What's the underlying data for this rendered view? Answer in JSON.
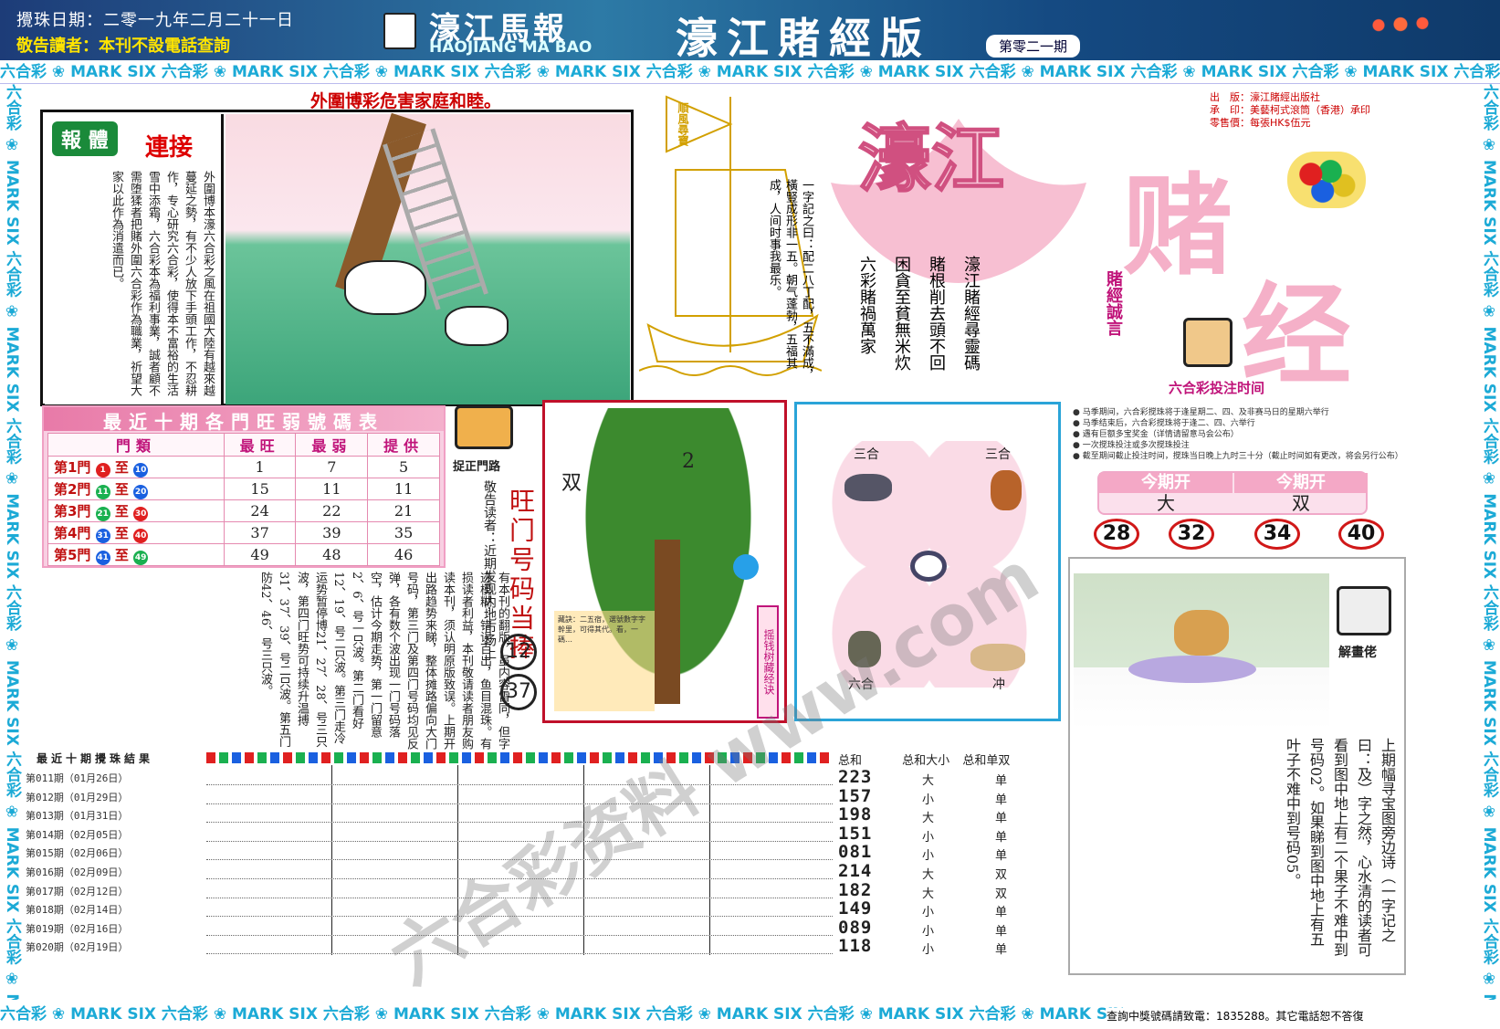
{
  "header": {
    "date": "攪珠日期：二零一九年二月二十一日",
    "notice": "敬告讀者：本刊不設電話查詢",
    "logo_cn": "濠江馬報",
    "logo_en": "HAOJIANG MA BAO",
    "title": "濠江賭經版",
    "issue": "第零二一期"
  },
  "band_text": "六合彩 ❀ MARK SIX 六合彩 ❀ MARK SIX 六合彩 ❀ MARK SIX 六合彩 ❀ MARK SIX 六合彩 ❀ MARK SIX 六合彩 ❀ MARK SIX 六合彩 ❀ MARK SIX 六合彩 ❀ MARK SIX 六合彩 ❀ MARK SIX 六合彩 ❀ MARK SIX",
  "ad": {
    "title": "外圍博彩危害家庭和睦。",
    "label": "報 體",
    "label2": "連接",
    "text": "外圍博本濠六合彩之風在祖國大陸有越來越蔓延之勢，有不少人放下手頭工作，不忍耕作，专心研究六合彩，使得本不富裕的生活雪中添霜，六合彩本為福利事業，誠者顧不需堕猱者把賭外圍六合彩作為職業，祈望大家以此作為消遣而已。"
  },
  "boat": {
    "flag": "順風尋寶",
    "text": "一字記之曰：配二八丁配，五不滿成，橫豎成形非一五。朝气蓬勃，五福其成，人间时事我最乐。"
  },
  "logo": {
    "haojiang": "濠江",
    "du": "赌",
    "jing": "经",
    "lines": [
      "六彩賭禍萬家",
      "困貪至貧無米炊",
      "賭根削去頭不回",
      "濠江賭經尋靈碼"
    ],
    "motto": "賭經誠言",
    "pub": [
      "出　版：濠江賭經出版社",
      "承　印：美藝柯式滾筒（香港）承印",
      "零售價：每張HK$伍元"
    ]
  },
  "time_box": {
    "title": "六合彩投注时间",
    "notes": [
      "● 马季期间，六合彩搅珠将于逢星期二、四、及非赛马日的星期六举行",
      "● 马季结束后，六合彩搅珠将于逢二、四、六举行",
      "● 遇有巨额多宝奖金（详情请留意马会公布）",
      "● 一次搅珠投注或多次搅珠投注",
      "● 截至期间截止投注时间，搅珠当日晚上九时三十分（截止时间如有更改，将会另行公布）"
    ],
    "current_head": "今期开",
    "current_1": "大",
    "current_2": "双",
    "numbers": [
      "28",
      "32",
      "34",
      "40"
    ]
  },
  "zodiac": {
    "top_left": "三合",
    "top_right": "三合",
    "bottom_left": "六合",
    "bottom_right": "冲"
  },
  "tree": {
    "left": "双",
    "right": "2",
    "side": "摇钱树藏经诀",
    "note": "藏訣：二五宿，選號數字字幹里，可得其代。看，一碼…"
  },
  "table": {
    "title": "最近十期各門旺弱號碼表",
    "headers": [
      "門類",
      "最旺",
      "最弱",
      "提供"
    ],
    "rows": [
      {
        "door": "第1門",
        "from": "1",
        "to": "10",
        "hot": "1",
        "cold": "7",
        "pick": "5"
      },
      {
        "door": "第2門",
        "from": "11",
        "to": "20",
        "hot": "15",
        "cold": "11",
        "pick": "11"
      },
      {
        "door": "第3門",
        "from": "21",
        "to": "30",
        "hot": "24",
        "cold": "22",
        "pick": "21"
      },
      {
        "door": "第4門",
        "from": "31",
        "to": "40",
        "hot": "37",
        "cold": "39",
        "pick": "35"
      },
      {
        "door": "第5門",
        "from": "41",
        "to": "49",
        "hot": "49",
        "cold": "48",
        "pick": "46"
      }
    ],
    "between": "至"
  },
  "tips": {
    "label": "捉正門路",
    "hot_title": "旺门号码当捧",
    "hot_1": "12",
    "hot_2": "37"
  },
  "article": "有本刊的翻版，虽内容雷同，但字迹模糊，错误百出，鱼目混珠。有损读者利益，本刊敬请读者朋友购读本刊，须认明原版致误。上期开出路趋势来睇，整体摊路偏向大门号码，第三门及第四门号码均见反弹，各有数个波出现一门号码落空，估计今期走势，第一门留意2、6、号一只波。第二门看好12、19、号二只波。第三门走冷运势暂停博21、27、28、号三只波，第四门旺势可持续升温搏31、37、39、号二只波。第五门防42、46、号三只波。",
  "article_head": "敬告读者：近期发现内地市场上",
  "results": {
    "title": "最近十期攪珠結果",
    "rows": [
      {
        "label": "第011期（01月26日）",
        "sum": "223",
        "bs": "大",
        "oe": "单"
      },
      {
        "label": "第012期（01月29日）",
        "sum": "157",
        "bs": "小",
        "oe": "单"
      },
      {
        "label": "第013期（01月31日）",
        "sum": "198",
        "bs": "大",
        "oe": "单"
      },
      {
        "label": "第014期（02月05日）",
        "sum": "151",
        "bs": "小",
        "oe": "单"
      },
      {
        "label": "第015期（02月06日）",
        "sum": "081",
        "bs": "小",
        "oe": "单"
      },
      {
        "label": "第016期（02月09日）",
        "sum": "214",
        "bs": "大",
        "oe": "双"
      },
      {
        "label": "第017期（02月12日）",
        "sum": "182",
        "bs": "大",
        "oe": "双"
      },
      {
        "label": "第018期（02月14日）",
        "sum": "149",
        "bs": "小",
        "oe": "单"
      },
      {
        "label": "第019期（02月16日）",
        "sum": "089",
        "bs": "小",
        "oe": "单"
      },
      {
        "label": "第020期（02月19日）",
        "sum": "118",
        "bs": "小",
        "oe": "单"
      }
    ],
    "head_sum": "总和",
    "head_bs": "总和大小",
    "head_oe": "总和单双"
  },
  "riddle": {
    "label": "解畫佬",
    "text": "上期幅寻宝图旁边诗（一字记之曰：及）字之然，心水清的读者可看到图中地上有二个果子不难中到号码02。如果睇到图中地上有五叶子不难中到号码05。"
  },
  "footer": "查詢中獎號碼請致電：1835288。其它電話恕不答復",
  "watermark": "六合彩资料 www.com",
  "colors": {
    "accent": "#c0147a",
    "band": "#1caad6",
    "header": "#1d3c78"
  }
}
